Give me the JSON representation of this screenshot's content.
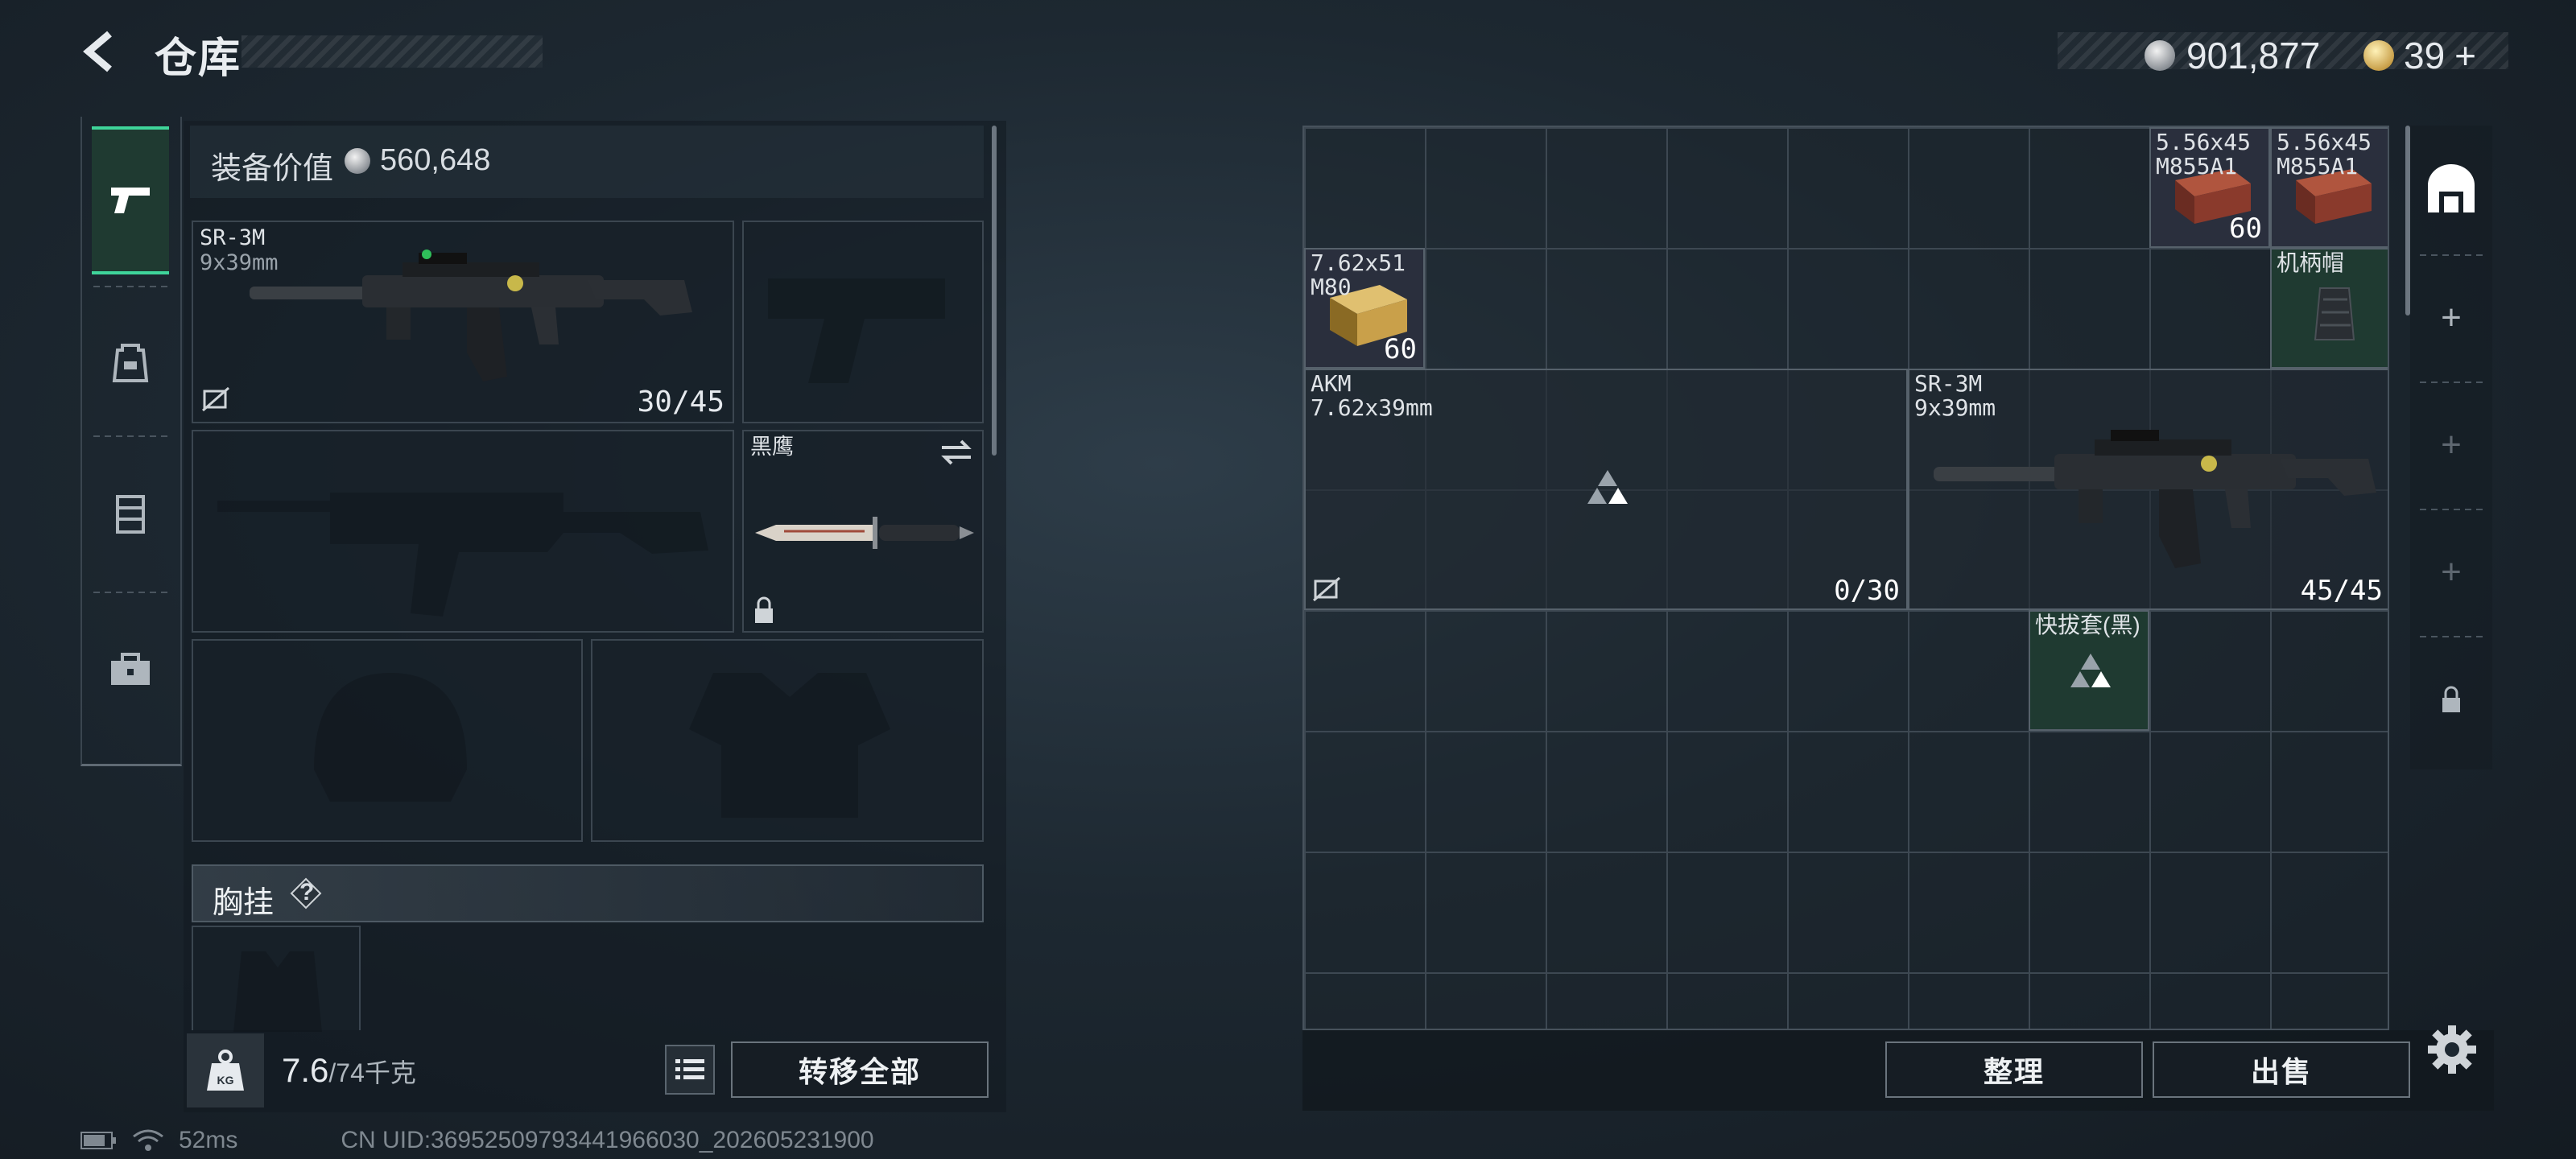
{
  "header": {
    "title": "仓库",
    "silver_amount": "901,877",
    "gold_amount": "39"
  },
  "nav": {
    "items": [
      "weapons",
      "backpack",
      "rig",
      "toolbox"
    ],
    "active": "weapons"
  },
  "equipment": {
    "value_label": "装备价值",
    "value": "560,648",
    "primary_weapon": {
      "name": "SR-3M",
      "caliber": "9x39mm",
      "ammo": "30/45"
    },
    "melee": {
      "name": "黑鹰"
    },
    "chest_rig_label": "胸挂",
    "chest_rig_help": "?"
  },
  "footer_left": {
    "weight": "7.6",
    "weight_capacity": "/74千克",
    "transfer_all": "转移全部"
  },
  "storage": {
    "ammo_556_a": {
      "name_line1": "5.56x45",
      "name_line2": "M855A1",
      "count": "60"
    },
    "ammo_556_b": {
      "name_line1": "5.56x45",
      "name_line2": "M855A1"
    },
    "ammo_762": {
      "name_line1": "7.62x51",
      "name_line2": "M80",
      "count": "60"
    },
    "grip_cap": {
      "name": "机柄帽"
    },
    "akm": {
      "name": "AKM",
      "caliber": "7.62x39mm",
      "ammo": "0/30"
    },
    "sr3m": {
      "name": "SR-3M",
      "caliber": "9x39mm",
      "ammo": "45/45"
    },
    "holster": {
      "name": "快拔套(黑)"
    }
  },
  "footer_right": {
    "sort": "整理",
    "sell": "出售"
  },
  "status": {
    "ping": "52ms",
    "uid": "CN UID:36952509793441966030_202605231900"
  },
  "colors": {
    "accent_green": "#3fd49a",
    "ammo_red": "#8a3a2c",
    "ammo_gold": "#c9a04a"
  }
}
